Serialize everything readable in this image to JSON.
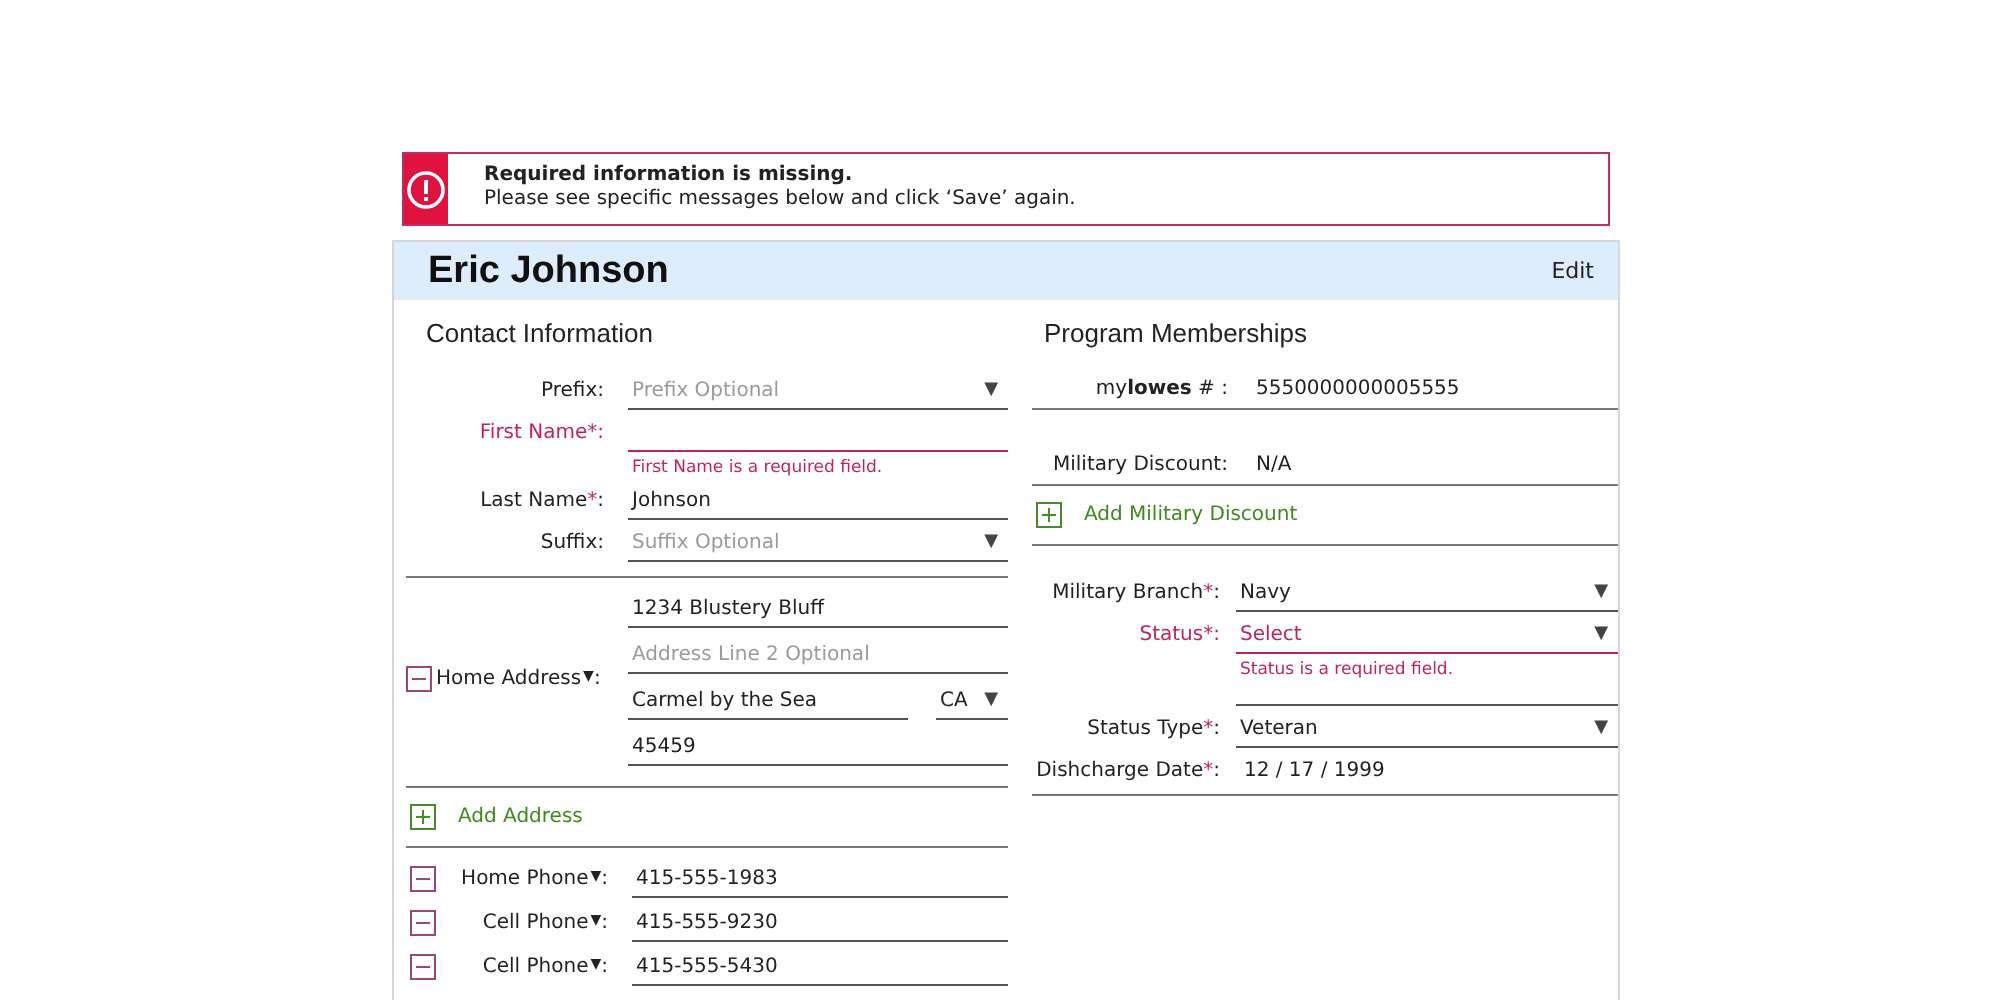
{
  "alert": {
    "title": "Required information is missing.",
    "message": "Please see specific messages below and click ‘Save’ again."
  },
  "header": {
    "name": "Eric Johnson",
    "edit": "Edit"
  },
  "contact": {
    "title": "Contact Information",
    "fields": [
      {
        "kind": "select",
        "label": "Prefix",
        "colon": ":",
        "placeholder": "Prefix Optional",
        "caret": "▼",
        "error": false
      },
      {
        "kind": "text",
        "label": "First Name",
        "required": "*",
        "colon": ":",
        "error": true,
        "error_message": "First Name is a required field."
      },
      {
        "kind": "text",
        "label": "Last Name",
        "required": "*",
        "colon": ":",
        "value": "Johnson",
        "error": false
      },
      {
        "kind": "select",
        "label": "Suffix",
        "colon": ":",
        "placeholder": "Suffix Optional",
        "caret": "▼",
        "error": false
      }
    ],
    "address": {
      "label": "Home Address",
      "caret": "▼",
      "colon": ":",
      "line1": "1234 Blustery Bluff",
      "line2_placeholder": "Address Line 2 Optional",
      "city": "Carmel by the Sea",
      "state": "CA",
      "state_caret": "▼",
      "zip": "45459"
    },
    "add_address": "Add Address",
    "phones": [
      {
        "label": "Home Phone",
        "caret": "▼",
        "colon": ":",
        "value": "415-555-1983"
      },
      {
        "label": "Cell Phone",
        "caret": "▼",
        "colon": ":",
        "value": "415-555-9230"
      },
      {
        "label": "Cell Phone",
        "caret": "▼",
        "colon": ":",
        "value": "415-555-5430"
      }
    ]
  },
  "memberships": {
    "title": "Program Memberships",
    "mylowes": {
      "label": "my**lowes** #",
      "colon": ":",
      "value": "5550000000005555"
    },
    "discount": {
      "label": "Military Discount",
      "colon": ":",
      "value": "N/A"
    },
    "add_discount": "Add Military Discount",
    "fields": [
      {
        "kind": "select",
        "label": "Military Branch",
        "required": "*",
        "colon": ":",
        "value": "Navy",
        "caret": "▼",
        "error": false
      },
      {
        "kind": "select",
        "label": "Status",
        "required": "*",
        "colon": ":",
        "value": "Select",
        "caret": "▼",
        "error": true,
        "error_message": "Status is a required field."
      },
      {
        "kind": "select",
        "label": "Status Type",
        "required": "*",
        "colon": ":",
        "value": "Veteran",
        "caret": "▼",
        "error": false
      },
      {
        "kind": "date",
        "label": "Dishcharge Date",
        "required": "*",
        "colon": ":",
        "value": "12 / 17 / 1999"
      }
    ]
  }
}
